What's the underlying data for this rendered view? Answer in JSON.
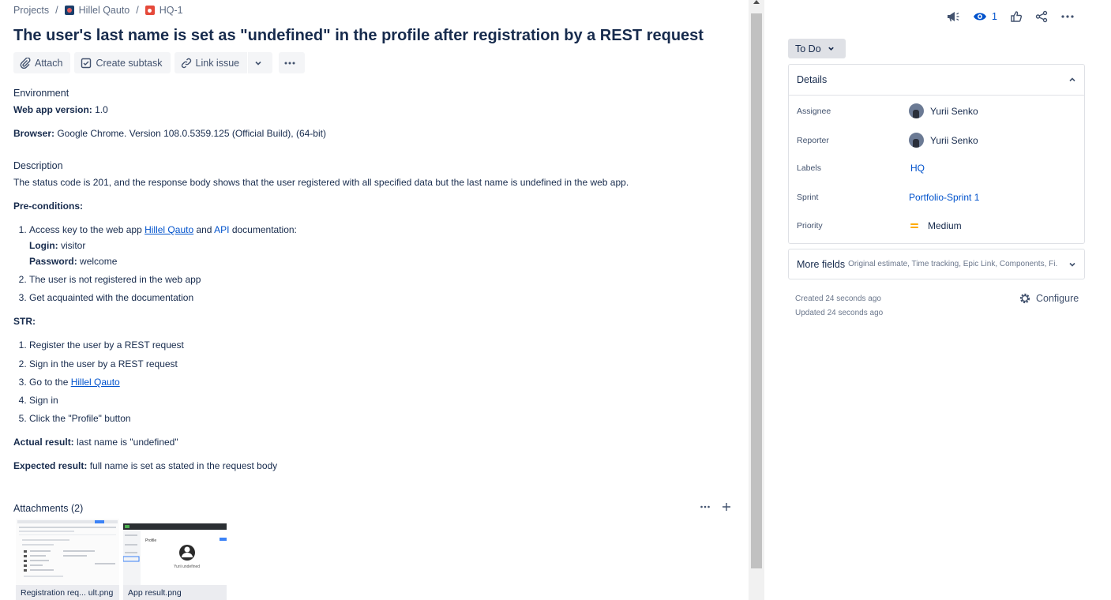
{
  "breadcrumb": {
    "projects": "Projects",
    "sep": "/",
    "project": "Hillel Qauto",
    "issue_key": "HQ-1"
  },
  "issue": {
    "title": "The user's last name is set as \"undefined\" in the profile after registration by a REST request"
  },
  "toolbar": {
    "attach": "Attach",
    "create_subtask": "Create subtask",
    "link_issue": "Link issue"
  },
  "content": {
    "environment_heading": "Environment",
    "web_app_version_label": "Web app version:",
    "web_app_version_value": " 1.0",
    "browser_label": "Browser:",
    "browser_value": " Google Chrome. Version 108.0.5359.125 (Official Build), (64-bit)",
    "description_heading": "Description",
    "description_text": "The status code is 201, and the response body shows that the user registered with all specified data but the last name is undefined in the web app.",
    "preconditions_label": "Pre-conditions:",
    "pre1_prefix": "Access key to the web app ",
    "pre1_link1": "Hillel Qauto",
    "pre1_and": " and ",
    "pre1_link2": "API",
    "pre1_suffix": " documentation:",
    "login_label": "Login:",
    "login_value": " visitor",
    "password_label": "Password:",
    "password_value": " welcome",
    "pre2": "The user is not registered in the web app",
    "pre3": "Get acquainted with the documentation",
    "str_label": "STR:",
    "str1": "Register the user by a REST request",
    "str2": "Sign in the user by a REST request",
    "str3_prefix": "Go to the ",
    "str3_link": "Hillel Qauto",
    "str4": "Sign in",
    "str5": "Click the \"Profile\" button",
    "actual_label": "Actual result:",
    "actual_value": " last name is \"undefined\"",
    "expected_label": "Expected result:",
    "expected_value": " full name is set as stated in the request body"
  },
  "attachments": {
    "header": "Attachments (2)",
    "items": [
      {
        "name": "Registration req... ult.png"
      },
      {
        "name": "App result.png"
      }
    ],
    "thumb2_heading": "Profile",
    "thumb2_name": "Yurii undefined"
  },
  "sidebar": {
    "watch_count": "1",
    "status": "To Do",
    "details_title": "Details",
    "assignee_label": "Assignee",
    "assignee": "Yurii Senko",
    "reporter_label": "Reporter",
    "reporter": "Yurii Senko",
    "labels_label": "Labels",
    "labels_value": "HQ",
    "sprint_label": "Sprint",
    "sprint_value": "Portfolio-Sprint 1",
    "priority_label": "Priority",
    "priority_value": "Medium",
    "more_fields": "More fields",
    "more_fields_sub": "Original estimate, Time tracking, Epic Link, Components, Fi...",
    "created": "Created 24 seconds ago",
    "updated": "Updated 24 seconds ago",
    "configure": "Configure"
  },
  "colors": {
    "accent": "#0052cc",
    "bug": "#e5493a",
    "priority_medium": "#ffab00"
  }
}
